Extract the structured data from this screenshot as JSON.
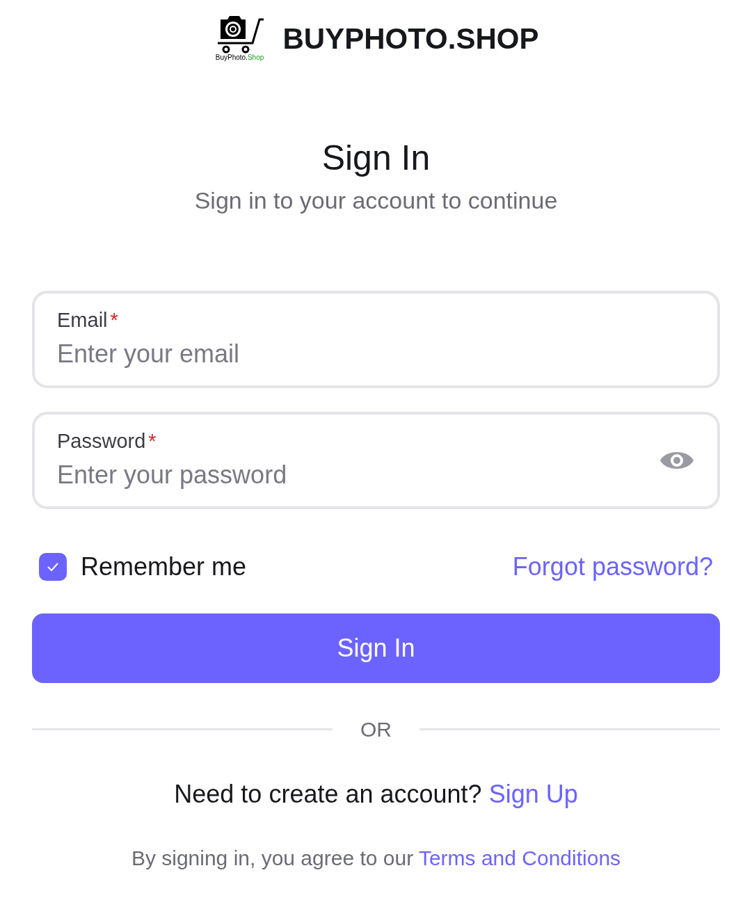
{
  "brand": {
    "logo_caption": [
      "BuyPhoto.",
      "Shop"
    ],
    "name": "BUYPHOTO.SHOP"
  },
  "title": "Sign In",
  "subtitle": "Sign in to your account to continue",
  "fields": [
    {
      "kind": "email",
      "label": "Email",
      "required_mark": "*",
      "placeholder": "Enter your email"
    },
    {
      "kind": "password",
      "label": "Password",
      "required_mark": "*",
      "placeholder": "Enter your password"
    }
  ],
  "remember": {
    "label": "Remember me",
    "checked": true
  },
  "forgot_link": "Forgot password?",
  "submit": "Sign In",
  "divider": "OR",
  "signup": {
    "prompt": "Need to create an account?",
    "link": "Sign Up"
  },
  "terms": {
    "text": "By signing in, you agree to our",
    "link": "Terms and Conditions"
  }
}
